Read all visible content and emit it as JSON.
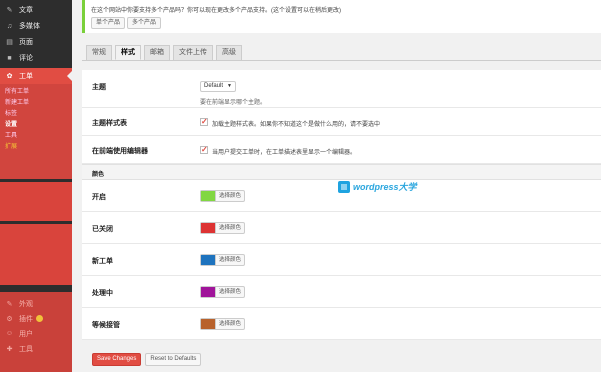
{
  "sidebar": {
    "top_items": [
      {
        "icon": "pin-icon",
        "label": "文章"
      },
      {
        "icon": "media-icon",
        "label": "多媒体"
      },
      {
        "icon": "page-icon",
        "label": "页面"
      },
      {
        "icon": "comment-icon",
        "label": "评论"
      }
    ],
    "active": {
      "icon": "ticket-icon",
      "label": "工单"
    },
    "submenu": [
      "所有工单",
      "新建工单",
      "标签",
      "设置",
      "工具",
      "扩展"
    ],
    "bottom_items": [
      {
        "icon": "appearance-icon",
        "label": "外观"
      },
      {
        "icon": "plugins-icon",
        "label": "插件"
      },
      {
        "icon": "users-icon",
        "label": "用户"
      },
      {
        "icon": "tools-icon",
        "label": "工具"
      }
    ]
  },
  "notice": {
    "text": "在这个网站中你要支持多个产品吗？你可以现在更改多个产品支持。(这个设置可以在稍后更改)",
    "btn_single": "单个产品",
    "btn_multi": "多个产品"
  },
  "tabs": [
    "常规",
    "样式",
    "邮箱",
    "文件上传",
    "高级"
  ],
  "active_tab": 1,
  "form": {
    "theme": {
      "label": "主题",
      "value": "Default",
      "desc": "要在前端显示哪个主题。"
    },
    "theme_style": {
      "label": "主题样式表",
      "text": "加载主题样式表。如果你不知道这个是做什么用的，请不要选中"
    },
    "editor": {
      "label": "在前端使用编辑器",
      "text": "当用户提交工单时，在工单描述表里显示一个编辑器。"
    },
    "colors_section": "颜色",
    "colors": [
      {
        "label": "开启",
        "color": "#81d742",
        "button": "选择颜色"
      },
      {
        "label": "已关闭",
        "color": "#dd3333",
        "button": "选择颜色"
      },
      {
        "label": "新工单",
        "color": "#1e73be",
        "button": "选择颜色"
      },
      {
        "label": "处理中",
        "color": "#a0149a",
        "button": "选择颜色"
      },
      {
        "label": "等候接管",
        "color": "#b8622c",
        "button": "选择颜色"
      }
    ]
  },
  "buttons": {
    "save": "Save Changes",
    "reset": "Reset to Defaults"
  },
  "watermark": "wordpress大学"
}
